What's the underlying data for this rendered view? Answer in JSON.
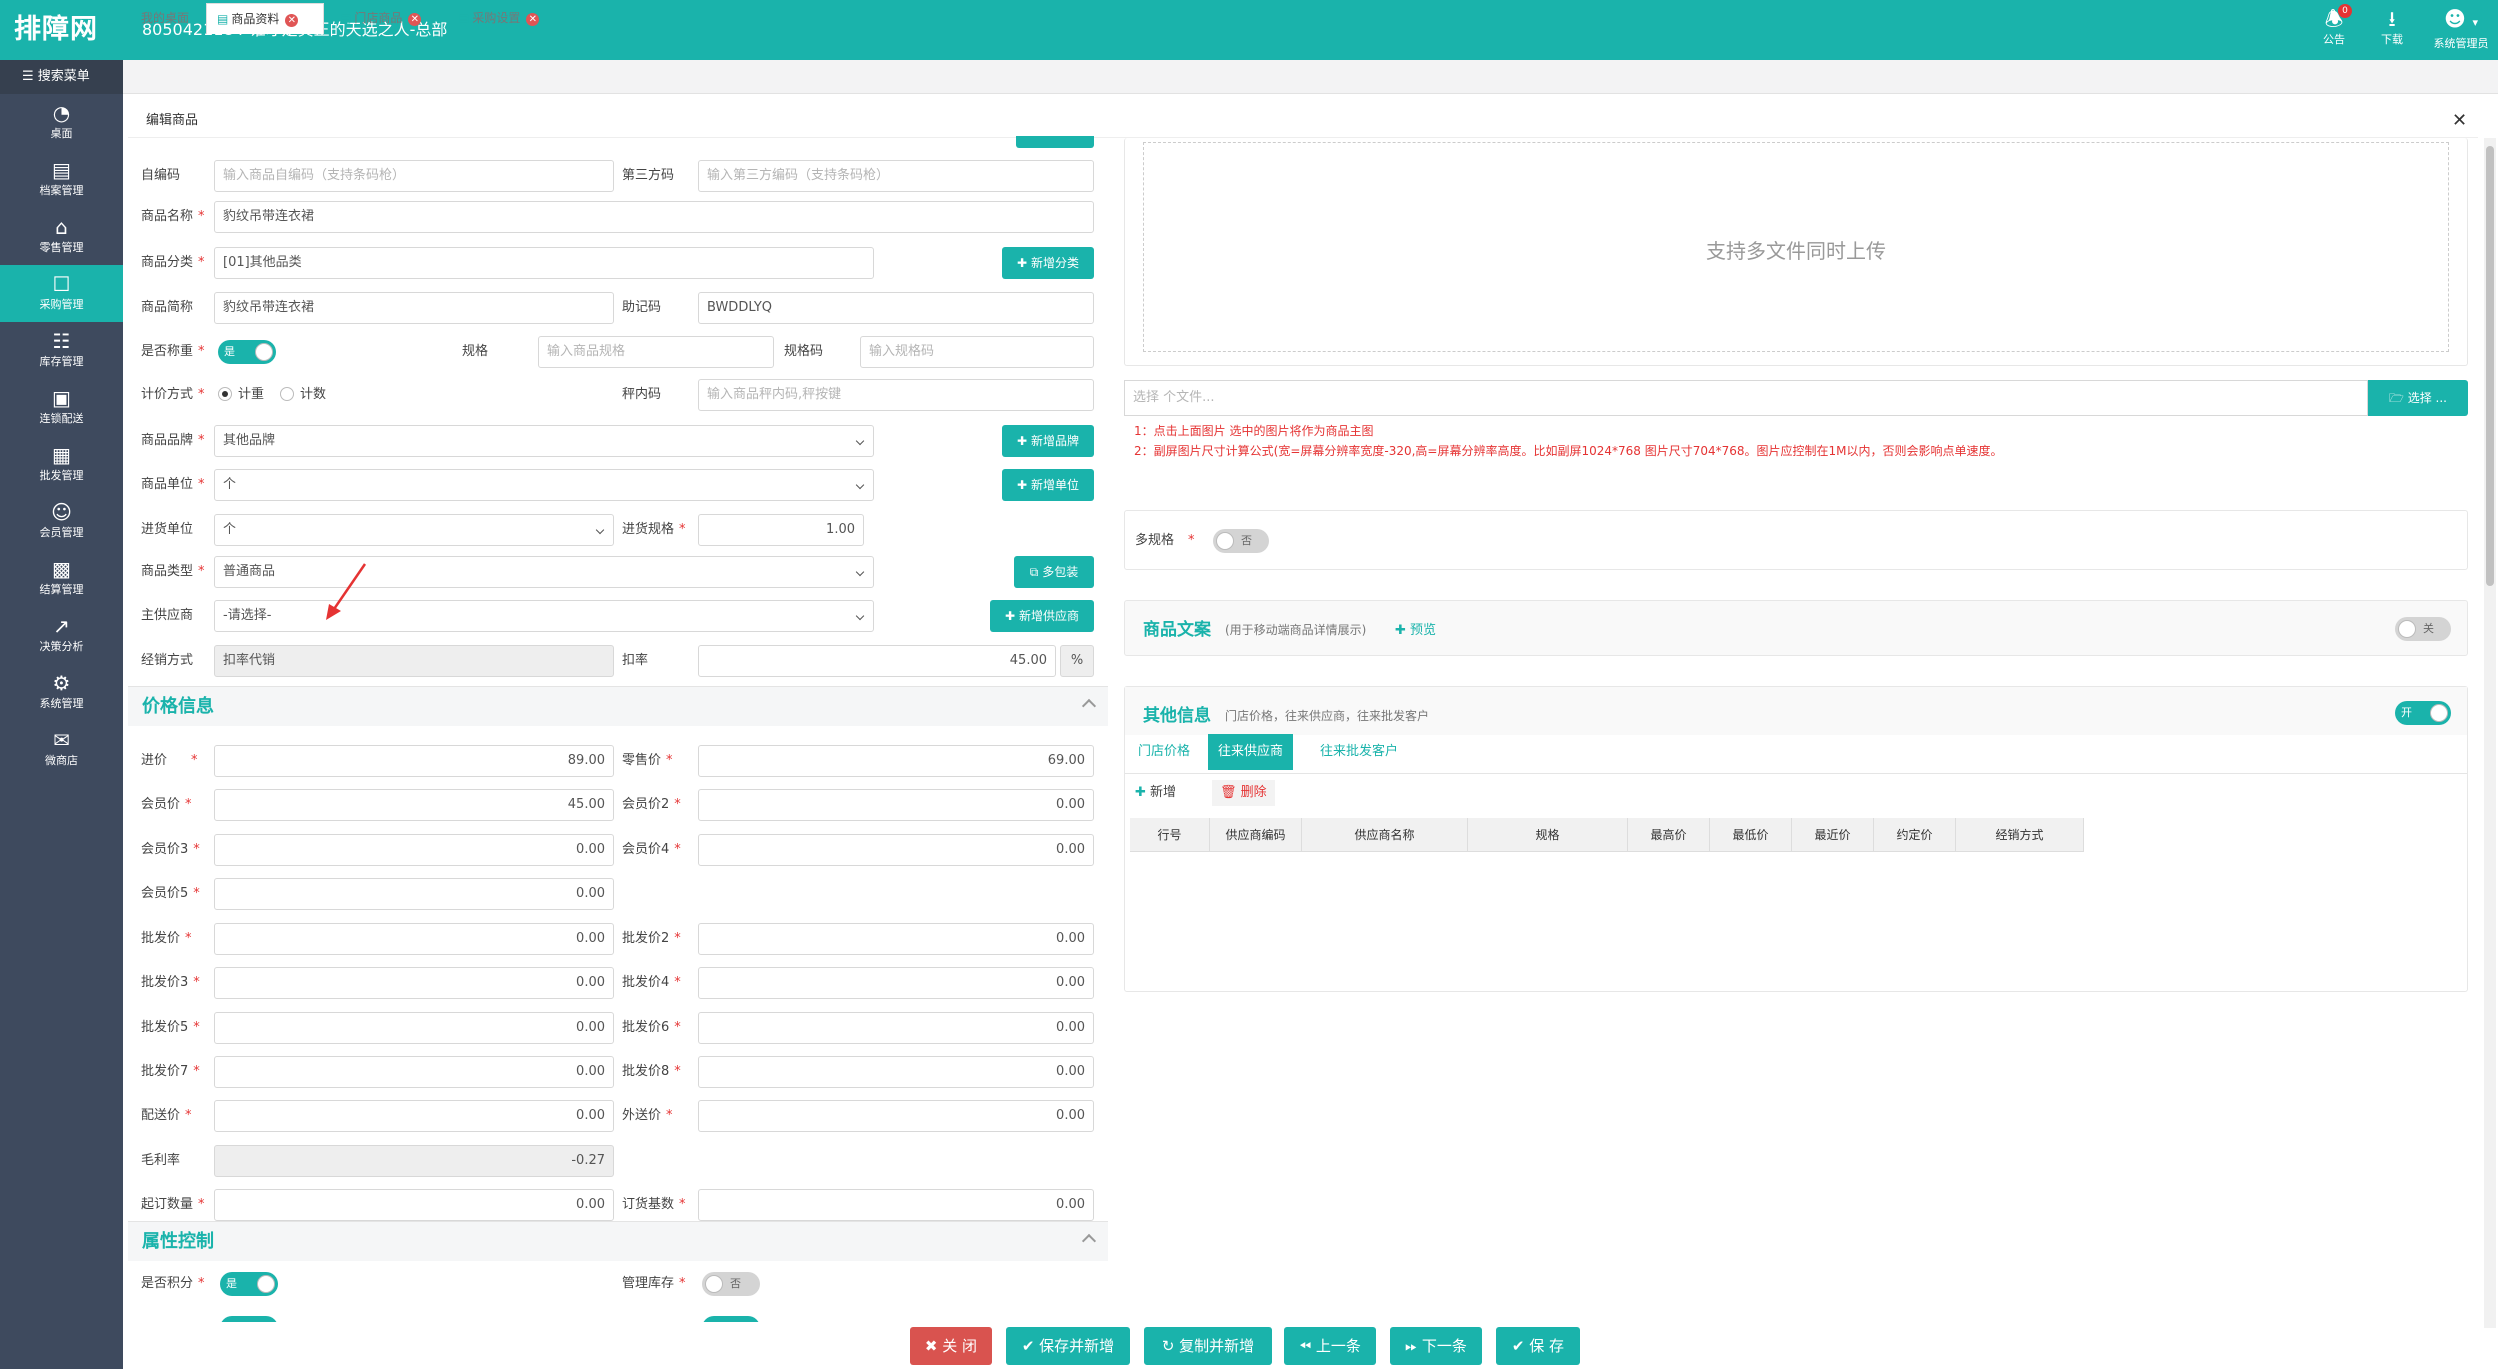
{
  "app": {
    "logo": "排障网",
    "title": "8050421184-谁才是真正的天选之人-总部",
    "notice": {
      "label": "公告",
      "badge": "0"
    },
    "download": "下载",
    "user": "系统管理员"
  },
  "sidebar": {
    "search": "搜索菜单",
    "items": [
      {
        "label": "桌面",
        "icon": "dashboard-icon"
      },
      {
        "label": "档案管理",
        "icon": "archive-icon"
      },
      {
        "label": "零售管理",
        "icon": "store-icon"
      },
      {
        "label": "采购管理",
        "icon": "cart-icon"
      },
      {
        "label": "库存管理",
        "icon": "inventory-icon"
      },
      {
        "label": "连锁配送",
        "icon": "delivery-icon"
      },
      {
        "label": "批发管理",
        "icon": "wholesale-icon"
      },
      {
        "label": "会员管理",
        "icon": "member-icon"
      },
      {
        "label": "结算管理",
        "icon": "settlement-icon"
      },
      {
        "label": "决策分析",
        "icon": "analysis-icon"
      },
      {
        "label": "系统管理",
        "icon": "settings-icon"
      },
      {
        "label": "微商店",
        "icon": "shop-icon"
      }
    ]
  },
  "tabs": [
    {
      "label": "我的桌面"
    },
    {
      "label": "商品资料"
    },
    {
      "label": "门店商品"
    },
    {
      "label": "采购设置"
    }
  ],
  "panel": {
    "title": "编辑商品"
  },
  "form": {
    "self_code": {
      "label": "自编码",
      "placeholder": "输入商品自编码（支持条码枪）"
    },
    "third_code": {
      "label": "第三方码",
      "placeholder": "输入第三方编码（支持条码枪）"
    },
    "name": {
      "label": "商品名称",
      "value": "豹纹吊带连衣裙"
    },
    "category": {
      "label": "商品分类",
      "value": "[01]其他品类",
      "button": "新增分类"
    },
    "short_name": {
      "label": "商品简称",
      "value": "豹纹吊带连衣裙"
    },
    "mnemonic": {
      "label": "助记码",
      "value": "BWDDLYQ"
    },
    "is_weighing": {
      "label": "是否称重",
      "value": "是"
    },
    "spec": {
      "label": "规格",
      "placeholder": "输入商品规格"
    },
    "spec_code": {
      "label": "规格码",
      "placeholder": "输入规格码"
    },
    "pricing": {
      "label": "计价方式",
      "options": [
        "计重",
        "计数"
      ]
    },
    "scale_code": {
      "label": "秤内码",
      "placeholder": "输入商品秤内码,秤按键"
    },
    "brand": {
      "label": "商品品牌",
      "value": "其他品牌",
      "button": "新增品牌"
    },
    "unit": {
      "label": "商品单位",
      "value": "个",
      "button": "新增单位"
    },
    "purchase_unit": {
      "label": "进货单位",
      "value": "个"
    },
    "purchase_spec": {
      "label": "进货规格",
      "value": "1.00"
    },
    "type": {
      "label": "商品类型",
      "value": "普通商品",
      "button": "多包装"
    },
    "supplier": {
      "label": "主供应商",
      "value": "-请选择-",
      "button": "新增供应商"
    },
    "sales_mode": {
      "label": "经销方式",
      "value": "扣率代销"
    },
    "discount": {
      "label": "扣率",
      "value": "45.00",
      "unit": "%"
    }
  },
  "price_section": {
    "title": "价格信息",
    "fields": [
      {
        "label": "进价",
        "value": "89.00"
      },
      {
        "label": "零售价",
        "value": "69.00"
      },
      {
        "label": "会员价",
        "value": "45.00"
      },
      {
        "label": "会员价2",
        "value": "0.00"
      },
      {
        "label": "会员价3",
        "value": "0.00"
      },
      {
        "label": "会员价4",
        "value": "0.00"
      },
      {
        "label": "会员价5",
        "value": "0.00"
      },
      {
        "label": "批发价",
        "value": "0.00"
      },
      {
        "label": "批发价2",
        "value": "0.00"
      },
      {
        "label": "批发价3",
        "value": "0.00"
      },
      {
        "label": "批发价4",
        "value": "0.00"
      },
      {
        "label": "批发价5",
        "value": "0.00"
      },
      {
        "label": "批发价6",
        "value": "0.00"
      },
      {
        "label": "批发价7",
        "value": "0.00"
      },
      {
        "label": "批发价8",
        "value": "0.00"
      },
      {
        "label": "配送价",
        "value": "0.00"
      },
      {
        "label": "外送价",
        "value": "0.00"
      },
      {
        "label": "毛利率",
        "value": "-0.27"
      },
      {
        "label": "起订数量",
        "value": "0.00"
      },
      {
        "label": "订货基数",
        "value": "0.00"
      }
    ]
  },
  "attr_section": {
    "title": "属性控制",
    "points": {
      "label": "是否积分",
      "value": "是"
    },
    "stock": {
      "label": "管理库存",
      "value": "否"
    }
  },
  "upload": {
    "drop_text": "支持多文件同时上传",
    "file_placeholder": "选择 个文件...",
    "choose_button": "选择 ...",
    "hint1": "1：点击上面图片 选中的图片将作为商品主图",
    "hint2": "2：副屏图片尺寸计算公式(宽=屏幕分辨率宽度-320,高=屏幕分辨率高度。比如副屏1024*768 图片尺寸704*768。图片应控制在1M以内，否则会影响点单速度。"
  },
  "multi_spec": {
    "label": "多规格",
    "value": "否"
  },
  "copy_section": {
    "title": "商品文案",
    "sub": "(用于移动端商品详情展示)",
    "preview": "预览",
    "toggle": "关"
  },
  "other_section": {
    "title": "其他信息",
    "sub": "门店价格，往来供应商，往来批发客户",
    "toggle": "开",
    "tabs": [
      "门店价格",
      "往来供应商",
      "往来批发客户"
    ],
    "add": "新增",
    "delete": "删除",
    "columns": [
      "行号",
      "供应商编码",
      "供应商名称",
      "规格",
      "最高价",
      "最低价",
      "最近价",
      "约定价",
      "经销方式"
    ]
  },
  "bottom_buttons": [
    "关 闭",
    "保存并新增",
    "复制并新增",
    "上一条",
    "下一条",
    "保 存"
  ],
  "colors": {
    "accent": "#1ab3ab",
    "sidebar": "#3e4a5e",
    "danger": "#d9534f",
    "required": "#e53333"
  }
}
